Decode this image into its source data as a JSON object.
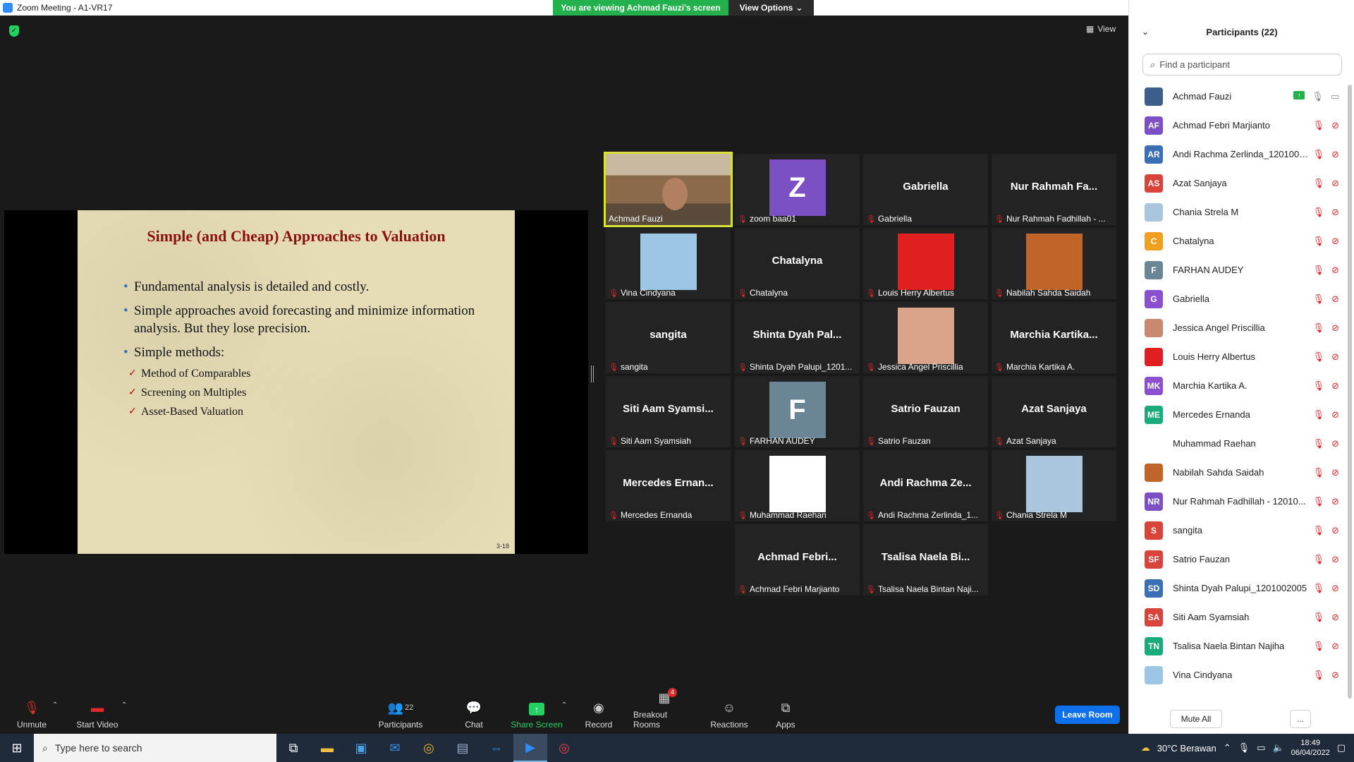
{
  "window": {
    "title": "Zoom Meeting - A1-VR17",
    "viewing_banner": "You are viewing Achmad Fauzi's screen",
    "view_options": "View Options"
  },
  "meeting": {
    "view_label": "View"
  },
  "slide": {
    "title": "Simple (and Cheap) Approaches to Valuation",
    "bullets": [
      "Fundamental analysis is detailed and costly.",
      "Simple approaches avoid forecasting and minimize information analysis. But they lose precision.",
      "Simple methods:"
    ],
    "methods": [
      "Method of Comparables",
      "Screening on Multiples",
      "Asset-Based Valuation"
    ],
    "page_number": "3-18"
  },
  "tiles": [
    {
      "label": "Achmad Fauzi",
      "type": "video"
    },
    {
      "label": "zoom baa01",
      "type": "letter",
      "letter": "Z",
      "color": "#7c4fc4"
    },
    {
      "label": "Gabriella",
      "center": "Gabriella",
      "type": "name"
    },
    {
      "label": "Nur Rahmah Fadhillah - ...",
      "center": "Nur Rahmah Fa...",
      "type": "name"
    },
    {
      "label": "Vina Cindyana",
      "type": "photo",
      "color": "#9cc6e6"
    },
    {
      "label": "Chatalyna",
      "center": "Chatalyna",
      "type": "name"
    },
    {
      "label": "Louis Herry Albertus",
      "type": "photo",
      "color": "#e02020"
    },
    {
      "label": "Nabilah Sahda Saidah",
      "type": "photo",
      "color": "#c0642a"
    },
    {
      "label": "sangita",
      "center": "sangita",
      "type": "name"
    },
    {
      "label": "Shinta Dyah Palupi_1201...",
      "center": "Shinta Dyah Pal...",
      "type": "name"
    },
    {
      "label": "Jessica Angel Priscillia",
      "type": "photo",
      "color": "#d9a48a"
    },
    {
      "label": "Marchia Kartika A.",
      "center": "Marchia Kartika...",
      "type": "name"
    },
    {
      "label": "Siti Aam Syamsiah",
      "center": "Siti Aam Syamsi...",
      "type": "name"
    },
    {
      "label": "FARHAN AUDEY",
      "type": "letter",
      "letter": "F",
      "color": "#6a8596"
    },
    {
      "label": "Satrio Fauzan",
      "center": "Satrio Fauzan",
      "type": "name"
    },
    {
      "label": "Azat Sanjaya",
      "center": "Azat Sanjaya",
      "type": "name"
    },
    {
      "label": "Mercedes Ernanda",
      "center": "Mercedes Ernan...",
      "type": "name"
    },
    {
      "label": "Muhammad Raehan",
      "type": "photo",
      "color": "#ffffff"
    },
    {
      "label": "Andi Rachma Zerlinda_1...",
      "center": "Andi Rachma Ze...",
      "type": "name"
    },
    {
      "label": "Chania Strela M",
      "type": "photo",
      "color": "#a9c6dc"
    },
    {
      "label": "Achmad Febri Marjianto",
      "center": "Achmad Febri...",
      "type": "name"
    },
    {
      "label": "Tsalisa Naela Bintan Naji...",
      "center": "Tsalisa Naela Bi...",
      "type": "name"
    }
  ],
  "toolbar": {
    "unmute": "Unmute",
    "start_video": "Start Video",
    "participants": "Participants",
    "participants_count": "22",
    "chat": "Chat",
    "share_screen": "Share Screen",
    "record": "Record",
    "breakout_rooms": "Breakout Rooms",
    "breakout_badge": "4",
    "reactions": "Reactions",
    "apps": "Apps",
    "leave_room": "Leave Room"
  },
  "panel": {
    "title": "Participants (22)",
    "search_placeholder": "Find a participant",
    "participants": [
      {
        "name": "Achmad Fauzi",
        "initials": "",
        "color": "#3b5f8a",
        "host": true
      },
      {
        "name": "Achmad Febri Marjianto",
        "initials": "AF",
        "color": "#7c4fc4"
      },
      {
        "name": "Andi Rachma Zerlinda_1201002...",
        "initials": "AR",
        "color": "#3b6fb5"
      },
      {
        "name": "Azat Sanjaya",
        "initials": "AS",
        "color": "#d9443a"
      },
      {
        "name": "Chania Strela M",
        "initials": "",
        "color": "#a9c6dc"
      },
      {
        "name": "Chatalyna",
        "initials": "C",
        "color": "#f0a020"
      },
      {
        "name": "FARHAN AUDEY",
        "initials": "F",
        "color": "#6a8596"
      },
      {
        "name": "Gabriella",
        "initials": "G",
        "color": "#8b4fd0"
      },
      {
        "name": "Jessica Angel Priscillia",
        "initials": "",
        "color": "#c98870"
      },
      {
        "name": "Louis Herry Albertus",
        "initials": "",
        "color": "#e02020"
      },
      {
        "name": "Marchia Kartika A.",
        "initials": "MK",
        "color": "#8b4fd0"
      },
      {
        "name": "Mercedes Ernanda",
        "initials": "ME",
        "color": "#1aab7a"
      },
      {
        "name": "Muhammad Raehan",
        "initials": "",
        "color": "#ffffff"
      },
      {
        "name": "Nabilah Sahda Saidah",
        "initials": "",
        "color": "#c0642a"
      },
      {
        "name": "Nur Rahmah Fadhillah - 12010...",
        "initials": "NR",
        "color": "#7c4fc4"
      },
      {
        "name": "sangita",
        "initials": "S",
        "color": "#d9443a"
      },
      {
        "name": "Satrio Fauzan",
        "initials": "SF",
        "color": "#d9443a"
      },
      {
        "name": "Shinta Dyah Palupi_1201002005",
        "initials": "SD",
        "color": "#3b6fb5"
      },
      {
        "name": "Siti Aam Syamsiah",
        "initials": "SA",
        "color": "#d9443a"
      },
      {
        "name": "Tsalisa Naela Bintan Najiha",
        "initials": "TN",
        "color": "#1aab7a"
      },
      {
        "name": "Vina Cindyana",
        "initials": "",
        "color": "#9cc6e6"
      }
    ],
    "mute_all": "Mute All",
    "more": "..."
  },
  "taskbar": {
    "search_placeholder": "Type here to search",
    "weather": "30°C  Berawan",
    "time": "18:49",
    "date": "06/04/2022"
  }
}
